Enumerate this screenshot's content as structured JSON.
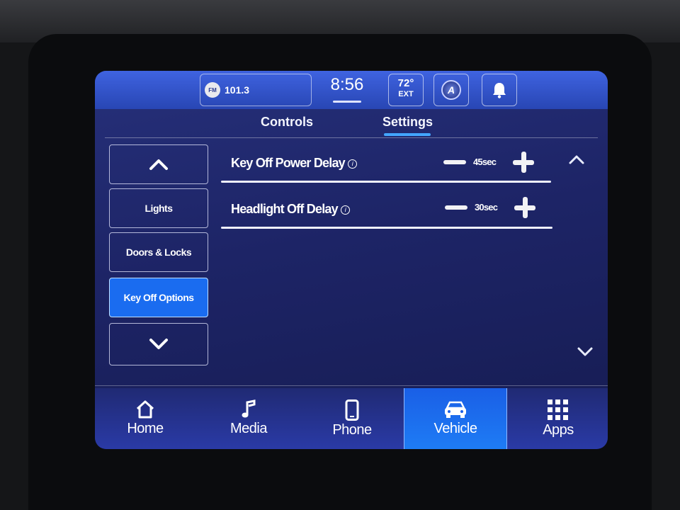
{
  "status_bar": {
    "radio_band": "FM",
    "radio_frequency": "101.3",
    "clock": "8:56",
    "temperature": "72°",
    "temperature_label": "EXT",
    "nav_icon": "navigation-badge-icon",
    "notification_icon": "bell-icon"
  },
  "tabs": {
    "controls": "Controls",
    "settings": "Settings",
    "active": "Settings"
  },
  "side_menu": {
    "up_icon": "chevron-up-icon",
    "items": [
      "Lights",
      "Doors & Locks",
      "Key Off Options"
    ],
    "active": "Key Off Options",
    "down_icon": "chevron-down-icon"
  },
  "settings_rows": [
    {
      "label": "Key Off Power Delay",
      "value": "45sec"
    },
    {
      "label": "Headlight Off Delay",
      "value": "30sec"
    }
  ],
  "bottom_nav": {
    "items": [
      "Home",
      "Media",
      "Phone",
      "Vehicle",
      "Apps"
    ],
    "icons": [
      "home-icon",
      "music-note-icon",
      "phone-icon",
      "car-icon",
      "apps-grid-icon"
    ],
    "active": "Vehicle"
  },
  "colors": {
    "accent": "#1a6cf0",
    "status_bar": "#3558cc",
    "background": "#1d2466"
  }
}
